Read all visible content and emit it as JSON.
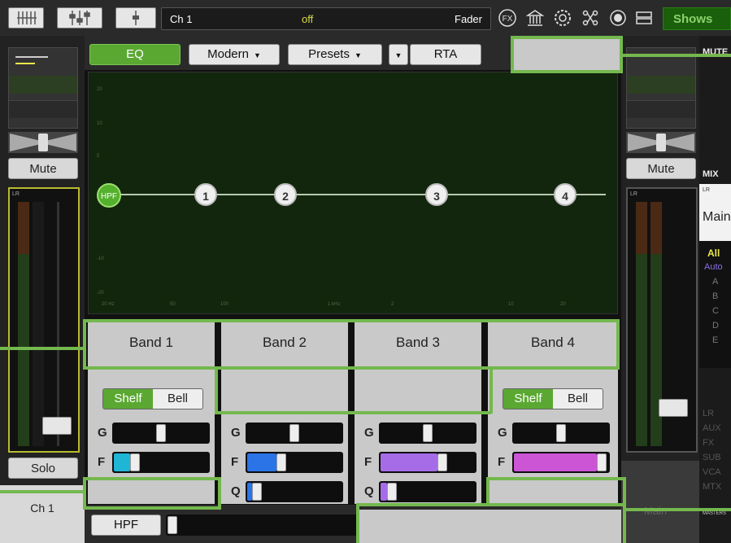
{
  "topbar": {
    "channel_name": "Ch 1",
    "status": "off",
    "mode": "Fader",
    "fx_label": "FX",
    "shows_label": "Shows"
  },
  "left_strip": {
    "mute_label": "Mute",
    "solo_label": "Solo",
    "channel_label": "Ch 1",
    "meter_label": "LR"
  },
  "eq_header": {
    "eq_label": "EQ",
    "modern_label": "Modern",
    "presets_label": "Presets",
    "rta_label": "RTA"
  },
  "graph": {
    "hpf_label": "HPF",
    "nodes": [
      {
        "label": "1"
      },
      {
        "label": "2"
      },
      {
        "label": "3"
      },
      {
        "label": "4"
      }
    ]
  },
  "bands": [
    {
      "title": "Band 1",
      "shelf": "Shelf",
      "bell": "Bell",
      "g": "G",
      "f": "F",
      "g_value": 0.55,
      "f_value": 0.15
    },
    {
      "title": "Band 2",
      "g": "G",
      "f": "F",
      "q": "Q",
      "g_value": 0.55,
      "f_value": 0.3,
      "q_value": 0.05
    },
    {
      "title": "Band 3",
      "g": "G",
      "f": "F",
      "q": "Q",
      "g_value": 0.55,
      "f_value": 0.6,
      "q_value": 0.07
    },
    {
      "title": "Band 4",
      "shelf": "Shelf",
      "bell": "Bell",
      "g": "G",
      "f": "F",
      "g_value": 0.55,
      "f_value": 0.88
    }
  ],
  "bottom": {
    "hpf_label": "HPF",
    "hpf_value": 0.0
  },
  "right_strip": {
    "mute_label": "Mute",
    "meter_label": "LR"
  },
  "mix_panel": {
    "mute_header": "MUTE",
    "mix_header": "MIX",
    "lr_label": "LR",
    "main_label": "Main",
    "filters": [
      "All",
      "Auto",
      "A",
      "B",
      "C",
      "D",
      "E"
    ],
    "groups": [
      "LR",
      "AUX",
      "FX",
      "SUB",
      "VCA",
      "MTX"
    ],
    "master_label": "MASTERS",
    "main_bottom": "Main"
  },
  "colors": {
    "accent_green": "#5aa832",
    "callout_green": "#74b84e",
    "band2_fill": "#2a74e8",
    "band3_fill": "#a66ce8",
    "band4_fill": "#cc55d6",
    "band1_fill": "#1fb6d6"
  }
}
